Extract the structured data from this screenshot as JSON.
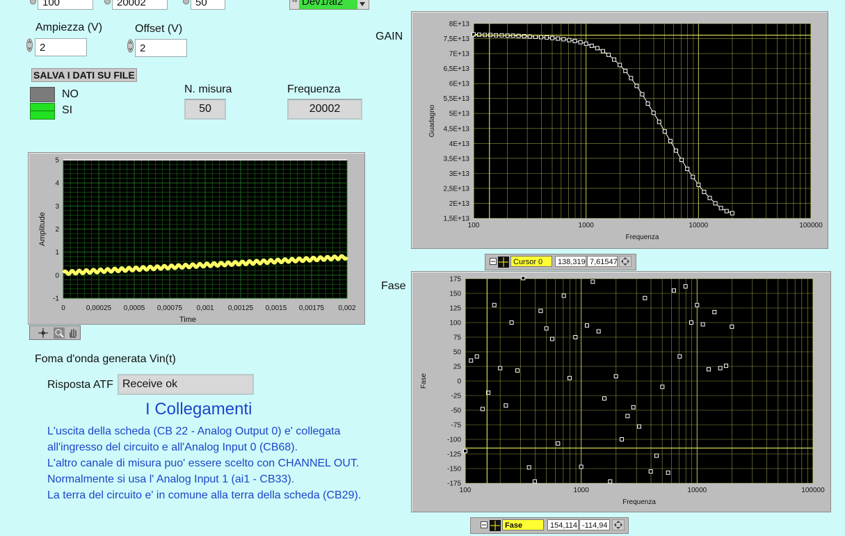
{
  "top_controls": {
    "field1": "100",
    "field2": "20002",
    "field3": "50",
    "channel_out": "Dev1/ai2"
  },
  "ampiezza": {
    "label": "Ampiezza (V)",
    "value": "2"
  },
  "offset": {
    "label": "Offset (V)",
    "value": "2"
  },
  "salva": {
    "label": "SALVA I DATI SU FILE",
    "no": "NO",
    "si": "SI"
  },
  "misura": {
    "label": "N. misura",
    "value": "50"
  },
  "frequenza": {
    "label": "Frequenza",
    "value": "20002"
  },
  "waveform": {
    "caption": "Foma d'onda generata Vin(t)",
    "ylabel": "Amplitude",
    "xlabel": "Time",
    "yticks": [
      "5",
      "4",
      "3",
      "2",
      "1",
      "0",
      "-1"
    ],
    "xticks": [
      "0",
      "0,00025",
      "0,0005",
      "0,00075",
      "0,001",
      "0,00125",
      "0,0015",
      "0,00175",
      "0,002"
    ]
  },
  "atf": {
    "label": "Risposta ATF",
    "value": "Receive ok"
  },
  "collegamenti": {
    "title": "I Collegamenti",
    "lines": [
      "L'uscita della scheda (CB 22 - Analog Output 0) e' collegata",
      "all'ingresso del circuito e all'Analog Input 0 (CB68).",
      "L'altro canale di misura puo' essere scelto con CHANNEL OUT.",
      "Normalmente si usa l' Analog Input 1 (ai1 - CB33).",
      "La terra del circuito e' in comune alla terra della scheda (CB29)."
    ]
  },
  "gain_chart": {
    "title": "GAIN",
    "ylabel": "Guadagno",
    "xlabel": "Frequenza",
    "yticks": [
      "8E+13",
      "7,5E+13",
      "7E+13",
      "6,5E+13",
      "6E+13",
      "5,5E+13",
      "5E+13",
      "4,5E+13",
      "4E+13",
      "3,5E+13",
      "3E+13",
      "2,5E+13",
      "2E+13",
      "1,5E+13"
    ],
    "xticks": [
      "100",
      "1000",
      "10000",
      "100000"
    ],
    "cursor": {
      "name": "Cursor 0",
      "x": "138,319",
      "y": "7,61547"
    }
  },
  "phase_chart": {
    "title": "Fase",
    "ylabel": "Fase",
    "xlabel": "Frequenza",
    "yticks": [
      "175",
      "150",
      "125",
      "100",
      "75",
      "50",
      "25",
      "0",
      "-25",
      "-50",
      "-75",
      "-100",
      "-125",
      "-150",
      "-175"
    ],
    "xticks": [
      "100",
      "1000",
      "10000",
      "100000"
    ],
    "cursor": {
      "name": "Fase",
      "x": "154,114",
      "y": "-114,94"
    }
  },
  "colors": {
    "background": "#cffafa",
    "plot_bg": "#000000",
    "grid": "#c8c85a",
    "trace_yellow": "#ffff66",
    "led_green": "#22e022",
    "accent_blue": "#1b46c8"
  },
  "chart_data": [
    {
      "type": "line",
      "title": "",
      "xlabel": "Frequenza",
      "ylabel": "Guadagno",
      "xscale": "log",
      "xlim": [
        100,
        100000
      ],
      "ylim": [
        15000000000000.0,
        80000000000000.0
      ],
      "x": [
        100,
        112,
        126,
        141,
        158,
        178,
        200,
        224,
        251,
        282,
        316,
        355,
        398,
        447,
        501,
        562,
        631,
        708,
        794,
        891,
        1000,
        1122,
        1259,
        1413,
        1585,
        1778,
        1995,
        2239,
        2512,
        2818,
        3162,
        3548,
        3981,
        4467,
        5012,
        5623,
        6310,
        7079,
        7943,
        8913,
        10000,
        11220,
        12589,
        14125,
        15849,
        17783,
        19953
      ],
      "y": [
        76400000000000.0,
        76300000000000.0,
        76200000000000.0,
        76200000000000.0,
        76100000000000.0,
        76100000000000.0,
        76000000000000.0,
        76000000000000.0,
        75900000000000.0,
        75800000000000.0,
        75700000000000.0,
        75600000000000.0,
        75500000000000.0,
        75400000000000.0,
        75200000000000.0,
        75000000000000.0,
        74800000000000.0,
        74500000000000.0,
        74200000000000.0,
        73800000000000.0,
        73300000000000.0,
        72600000000000.0,
        71800000000000.0,
        70800000000000.0,
        69600000000000.0,
        68000000000000.0,
        66200000000000.0,
        64200000000000.0,
        61800000000000.0,
        59200000000000.0,
        56400000000000.0,
        53300000000000.0,
        50200000000000.0,
        47200000000000.0,
        44000000000000.0,
        40800000000000.0,
        37600000000000.0,
        34500000000000.0,
        31500000000000.0,
        28800000000000.0,
        26200000000000.0,
        23800000000000.0,
        21800000000000.0,
        20000000000000.0,
        18400000000000.0,
        17400000000000.0,
        16700000000000.0
      ]
    },
    {
      "type": "scatter",
      "title": "",
      "xlabel": "Frequenza",
      "ylabel": "Fase",
      "xscale": "log",
      "xlim": [
        100,
        100000
      ],
      "ylim": [
        -175,
        175
      ],
      "x": [
        100,
        112,
        126,
        141,
        158,
        178,
        200,
        224,
        251,
        282,
        316,
        355,
        398,
        447,
        501,
        562,
        631,
        708,
        794,
        891,
        1000,
        1122,
        1259,
        1413,
        1585,
        1778,
        1995,
        2239,
        2512,
        2818,
        3162,
        3548,
        3981,
        4467,
        5012,
        5623,
        6310,
        7079,
        7943,
        8913,
        10000,
        11220,
        12589,
        14125,
        15849,
        17783,
        19953
      ],
      "y": [
        -120,
        35,
        42,
        -48,
        -20,
        130,
        22,
        -42,
        100,
        18,
        176,
        -148,
        -172,
        120,
        90,
        72,
        -107,
        146,
        5,
        75,
        -147,
        95,
        170,
        85,
        -30,
        -172,
        8,
        -100,
        -60,
        -45,
        -78,
        142,
        -155,
        -128,
        -10,
        -157,
        155,
        42,
        162,
        100,
        130,
        97,
        20,
        118,
        22,
        26,
        93
      ]
    },
    {
      "type": "line",
      "title": "",
      "xlabel": "Time",
      "ylabel": "Amplitude",
      "xlim": [
        0,
        0.002
      ],
      "ylim": [
        -1,
        5
      ],
      "x": [
        0,
        0.002
      ],
      "y": [
        0.1,
        0.78
      ]
    }
  ]
}
